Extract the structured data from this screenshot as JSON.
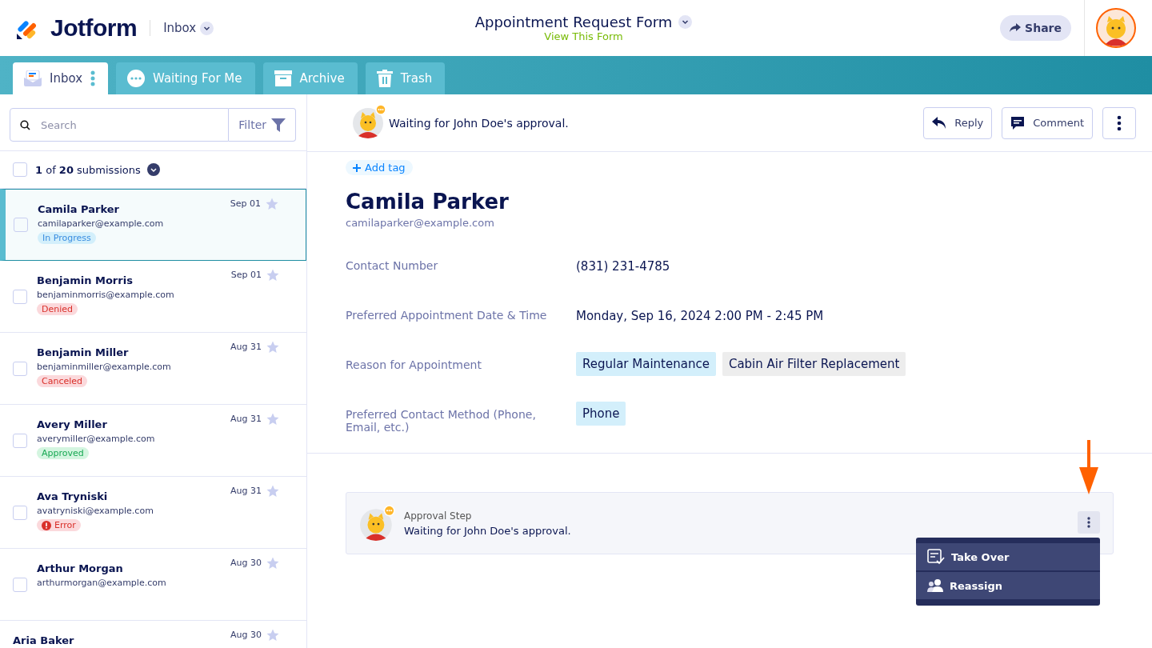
{
  "header": {
    "logo": "Jotform",
    "section": "Inbox",
    "form_title": "Appointment Request Form",
    "form_link": "View This Form",
    "share": "Share"
  },
  "tabs": [
    {
      "label": "Inbox",
      "selected": true
    },
    {
      "label": "Waiting For Me",
      "selected": false
    },
    {
      "label": "Archive",
      "selected": false
    },
    {
      "label": "Trash",
      "selected": false
    }
  ],
  "sidebar": {
    "search": {
      "placeholder": "Search"
    },
    "filter": "Filter",
    "select_all_checked": false,
    "count": "**1** of **20** submissions",
    "items": [
      {
        "name": "Camila Parker",
        "email": "camilaparker@example.com",
        "date": "Sep 01",
        "status": "In Progress",
        "kind": "progress",
        "selected": true,
        "checked": false,
        "starred": false
      },
      {
        "name": "Benjamin Morris",
        "email": "benjaminmorris@example.com",
        "date": "Sep 01",
        "status": "Denied",
        "kind": "denied",
        "selected": false,
        "checked": false,
        "starred": false
      },
      {
        "name": "Benjamin Miller",
        "email": "benjaminmiller@example.com",
        "date": "Aug 31",
        "status": "Canceled",
        "kind": "canceled",
        "selected": false,
        "checked": false,
        "starred": false
      },
      {
        "name": "Avery Miller",
        "email": "averymiller@example.com",
        "date": "Aug 31",
        "status": "Approved",
        "kind": "approved",
        "selected": false,
        "checked": false,
        "starred": false
      },
      {
        "name": "Ava Tryniski",
        "email": "avatryniski@example.com",
        "date": "Aug 31",
        "status": "Error",
        "kind": "error",
        "selected": false,
        "checked": false,
        "starred": false
      },
      {
        "name": "Arthur Morgan",
        "email": "arthurmorgan@example.com",
        "date": "Aug 30",
        "selected": false,
        "checked": false,
        "starred": false
      },
      {
        "name": "Aria Baker",
        "date": "Aug 30",
        "selected": false,
        "starred": false
      }
    ]
  },
  "detail": {
    "status_text": "Waiting for John Doe's approval.",
    "reply": "Reply",
    "comment": "Comment",
    "add_tag": "Add tag",
    "name": "Camila Parker",
    "email": "camilaparker@example.com",
    "fields": [
      {
        "label": "Contact Number",
        "kind": "text",
        "value": "(831) 231-4785"
      },
      {
        "label": "Preferred Appointment Date & Time",
        "kind": "text",
        "value": "Monday, Sep 16, 2024 2:00 PM - 2:45 PM"
      },
      {
        "label": "Reason for Appointment",
        "kind": "tags",
        "tags": [
          {
            "text": "Regular Maintenance",
            "color": "#d3effb"
          },
          {
            "text": "Cabin Air Filter Replacement",
            "color": "#ededed"
          }
        ]
      },
      {
        "label": "Preferred Contact Method (Phone, Email, etc.)",
        "kind": "tags",
        "tags": [
          {
            "text": "Phone",
            "color": "#d3effb"
          }
        ]
      }
    ],
    "approval": {
      "title": "Approval Step",
      "text": "Waiting for John Doe's approval.",
      "menu": [
        {
          "label": "Take Over"
        },
        {
          "label": "Reassign"
        }
      ]
    }
  }
}
